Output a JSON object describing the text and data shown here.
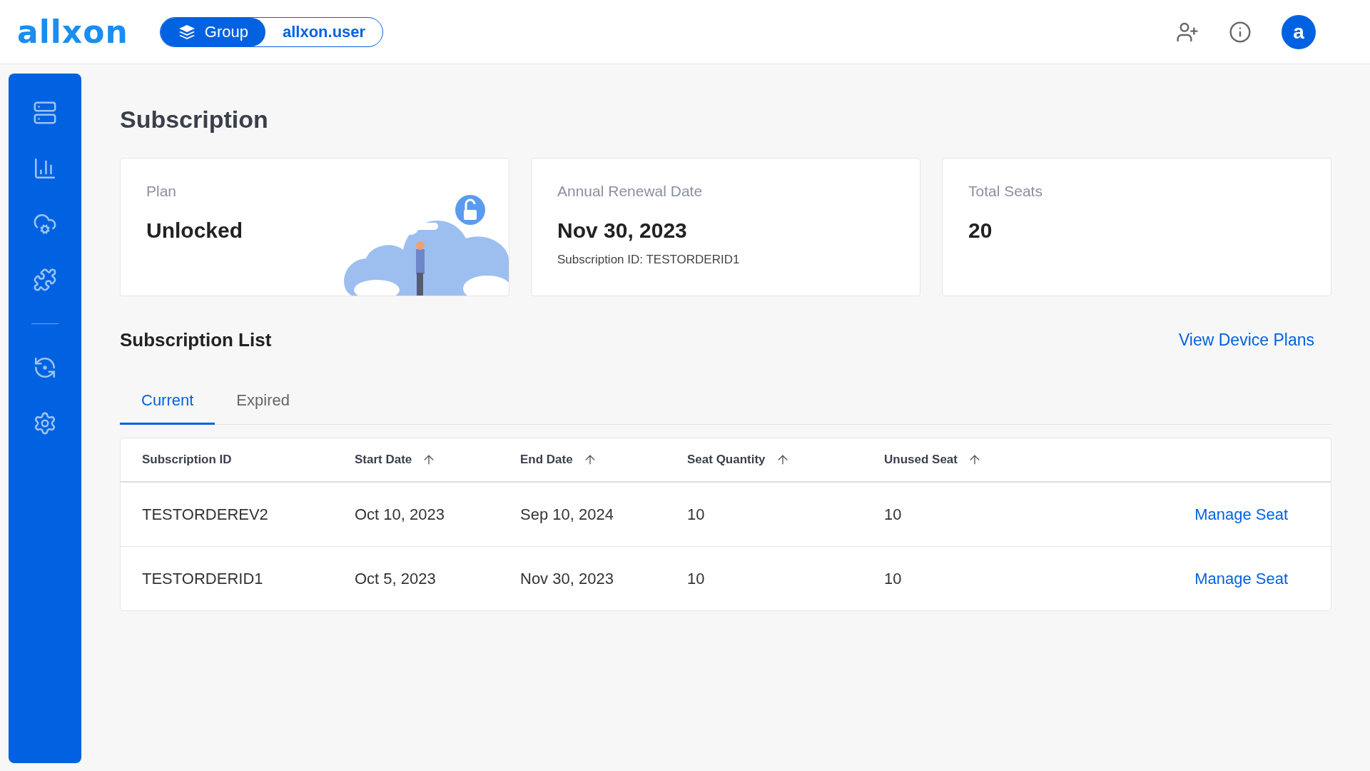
{
  "header": {
    "logo": "allxon",
    "scope_toggle": [
      {
        "label": "Group",
        "selected": true
      },
      {
        "label": "allxon.user",
        "selected": false
      }
    ],
    "avatar": "a"
  },
  "page": {
    "title": "Subscription",
    "cards": [
      {
        "kind": "plan",
        "label": "Plan",
        "value": "Unlocked"
      },
      {
        "kind": "renewal",
        "label": "Annual Renewal Date",
        "value": "Nov 30, 2023",
        "note": "Subscription ID: TESTORDERID1"
      },
      {
        "kind": "seats",
        "label": "Total Seats",
        "value": "20"
      }
    ],
    "list_title": "Subscription List",
    "link": "View Device Plans",
    "tabs": [
      {
        "label": "Current",
        "selected": true
      },
      {
        "label": "Expired",
        "selected": false
      }
    ],
    "table": {
      "columns": [
        {
          "label": "Subscription ID",
          "sortable": false
        },
        {
          "label": "Start Date",
          "sortable": true
        },
        {
          "label": "End Date",
          "sortable": true
        },
        {
          "label": "Seat Quantity",
          "sortable": true
        },
        {
          "label": "Unused Seat",
          "sortable": true
        }
      ],
      "rows": [
        {
          "cells": [
            "TESTORDEREV2",
            "Oct 10, 2023",
            "Sep 10, 2024",
            "10",
            "10"
          ],
          "action": "Manage Seat"
        },
        {
          "cells": [
            "TESTORDERID1",
            "Oct 5, 2023",
            "Nov 30, 2023",
            "10",
            "10"
          ],
          "action": "Manage Seat"
        }
      ]
    }
  }
}
